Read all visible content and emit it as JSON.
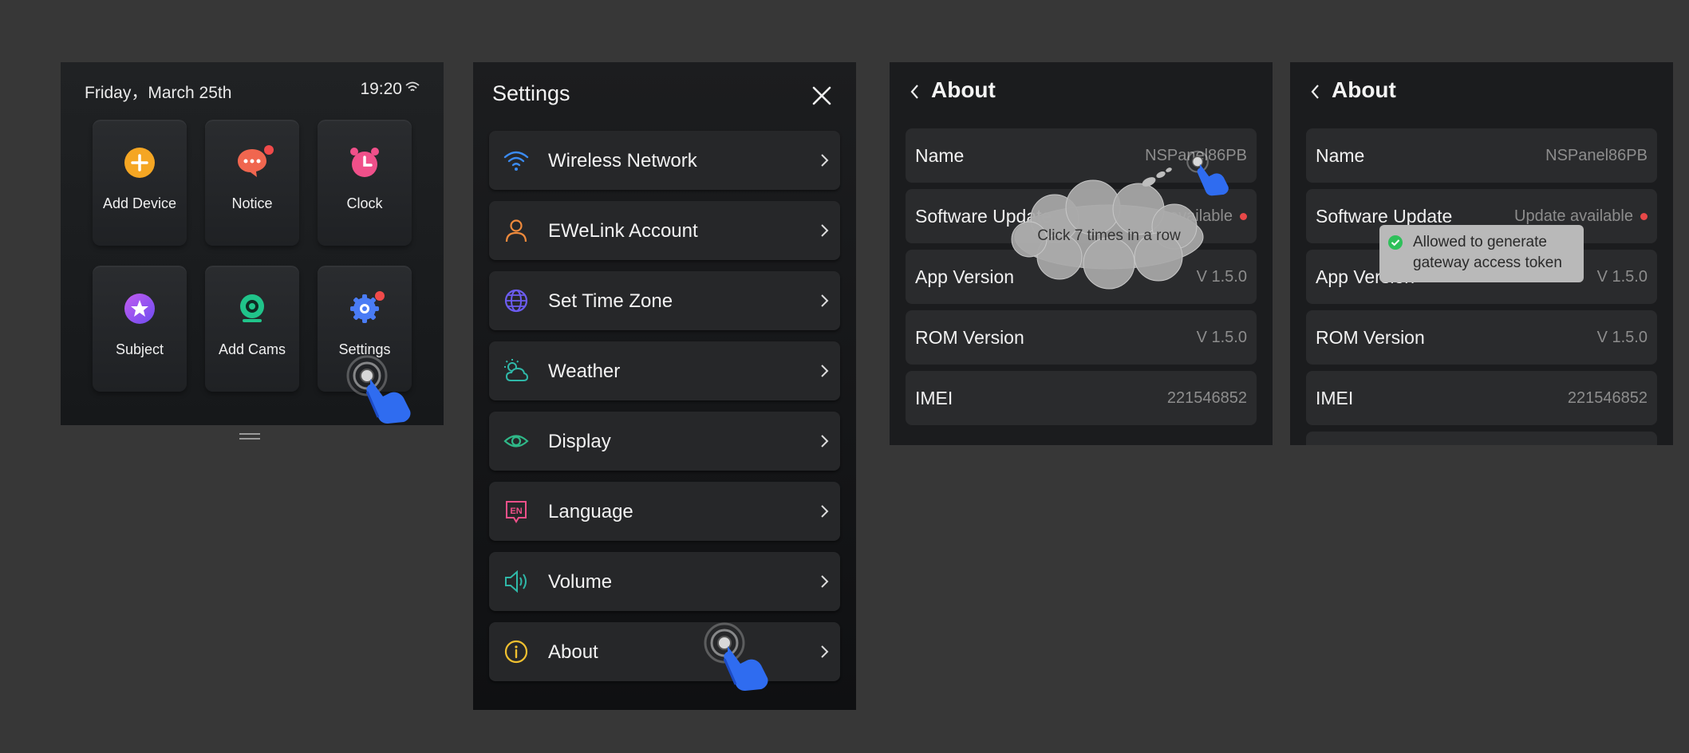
{
  "home": {
    "date": "Friday，March 25th",
    "time": "19:20",
    "tiles": [
      {
        "label": "Add Device",
        "icon": "add-device-icon",
        "color": "#f5a623"
      },
      {
        "label": "Notice",
        "icon": "notice-icon",
        "color": "#f0664f"
      },
      {
        "label": "Clock",
        "icon": "clock-icon",
        "color": "#f0508a"
      },
      {
        "label": "Subject",
        "icon": "subject-icon",
        "color": "#9b5cf0"
      },
      {
        "label": "Add Cams",
        "icon": "camera-icon",
        "color": "#20c48a"
      },
      {
        "label": "Settings",
        "icon": "gear-icon",
        "color": "#4a7cf5"
      }
    ]
  },
  "settings": {
    "title": "Settings",
    "items": [
      {
        "label": "Wireless Network",
        "icon": "wifi-icon",
        "color": "#3b8bf0"
      },
      {
        "label": "EWeLink Account",
        "icon": "user-icon",
        "color": "#f08a3c"
      },
      {
        "label": "Set Time Zone",
        "icon": "globe-icon",
        "color": "#6c5cf0"
      },
      {
        "label": "Weather",
        "icon": "weather-icon",
        "color": "#2fb8a8"
      },
      {
        "label": "Display",
        "icon": "eye-icon",
        "color": "#2fb888"
      },
      {
        "label": "Language",
        "icon": "language-icon",
        "color": "#f0508a"
      },
      {
        "label": "Volume",
        "icon": "volume-icon",
        "color": "#2fb8a8"
      },
      {
        "label": "About",
        "icon": "info-icon",
        "color": "#f0c030"
      }
    ]
  },
  "about1": {
    "title": "About",
    "rows": [
      {
        "label": "Name",
        "value": "NSPanel86PB"
      },
      {
        "label": "Software Update",
        "value": "Update available"
      },
      {
        "label": "App Version",
        "value": "V 1.5.0"
      },
      {
        "label": "ROM Version",
        "value": "V 1.5.0"
      },
      {
        "label": "IMEI",
        "value": "221546852"
      }
    ],
    "tip": "Click 7 times in a row"
  },
  "about2": {
    "title": "About",
    "rows": [
      {
        "label": "Name",
        "value": "NSPanel86PB"
      },
      {
        "label": "Software Update",
        "value": "Update available"
      },
      {
        "label": "App Version",
        "value": "V 1.5.0"
      },
      {
        "label": "ROM Version",
        "value": "V 1.5.0"
      },
      {
        "label": "IMEI",
        "value": "221546852"
      }
    ],
    "toast": "Allowed to generate gateway access token"
  },
  "colors": {
    "background": "#373737",
    "hand": "#2f6cf0",
    "update_dot": "#e74848",
    "toast_check": "#2ec05a"
  }
}
